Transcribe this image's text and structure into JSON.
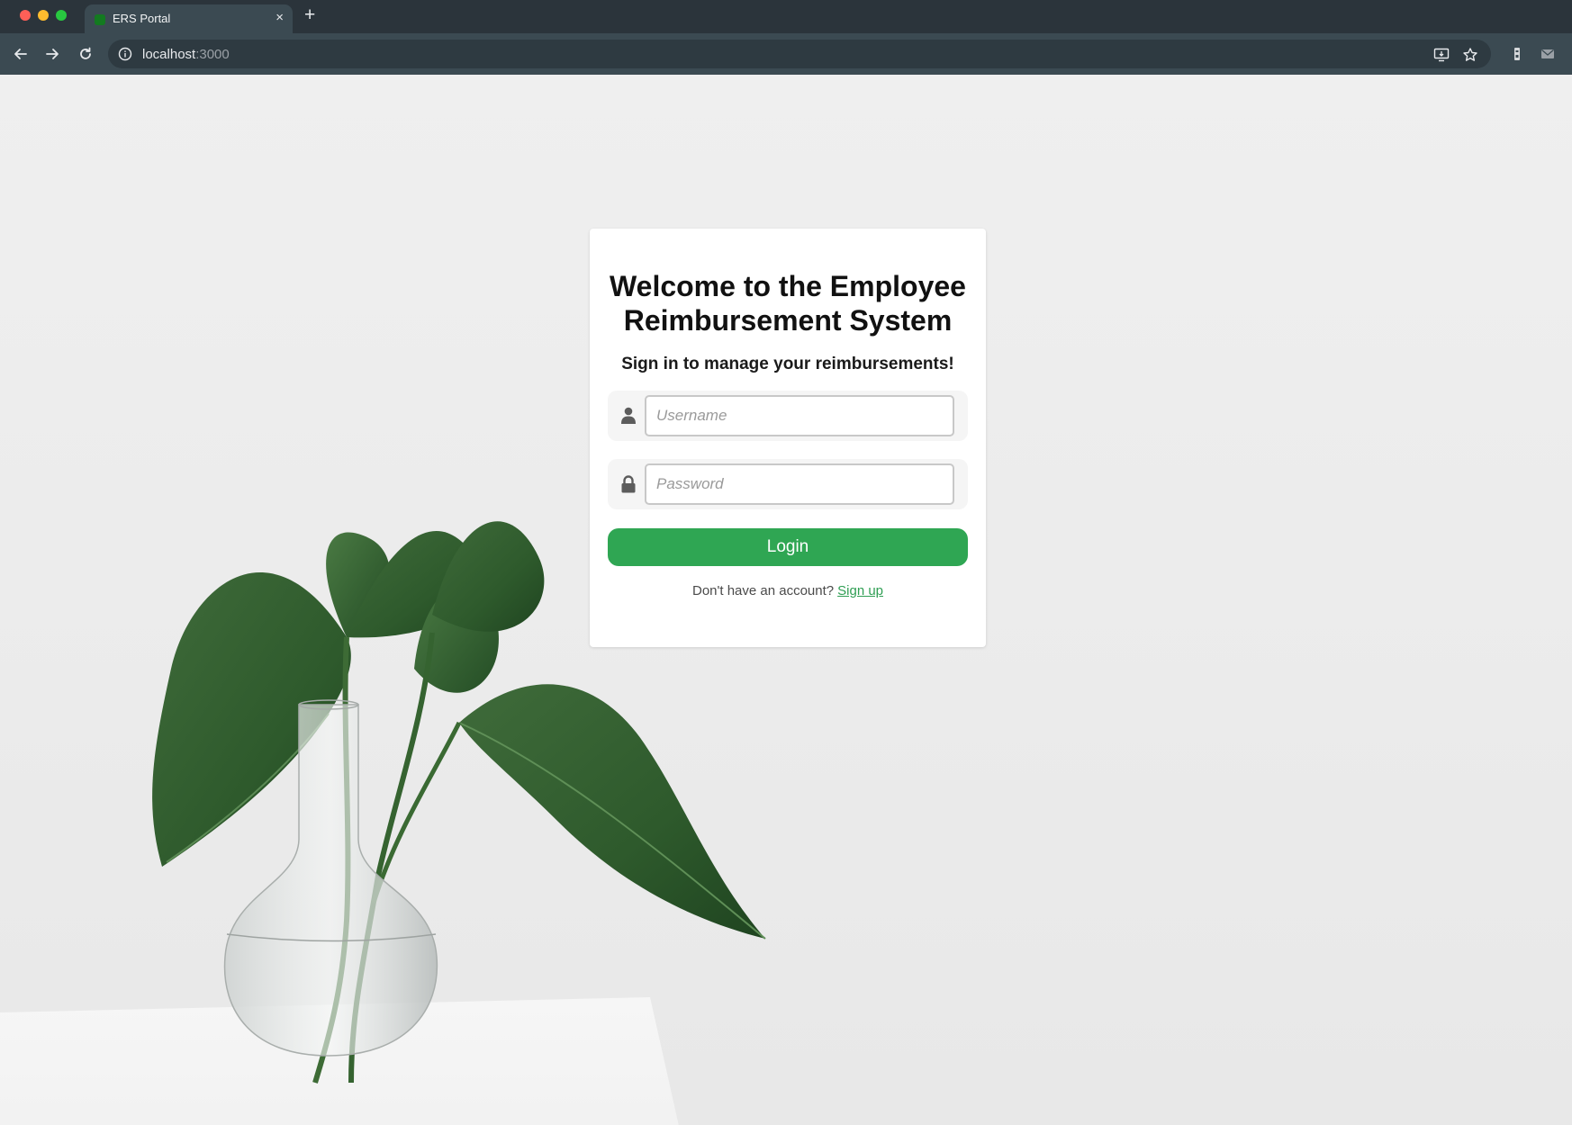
{
  "browser": {
    "tab_title": "ERS Portal",
    "tab_close": "×",
    "new_tab": "+",
    "url_host": "localhost",
    "url_port": ":3000"
  },
  "page": {
    "title": "Welcome to the Employee Reimbursement System",
    "subtitle": "Sign in to manage your reimbursements!",
    "username_placeholder": "Username",
    "password_placeholder": "Password",
    "login_label": "Login",
    "signup_prompt": "Don't have an account?",
    "signup_link": "Sign up"
  },
  "icons": {
    "username": "user-icon",
    "password": "lock-icon"
  },
  "colors": {
    "accent": "#2fa653",
    "link": "#2f9e53",
    "chrome": "#3b4a52"
  }
}
